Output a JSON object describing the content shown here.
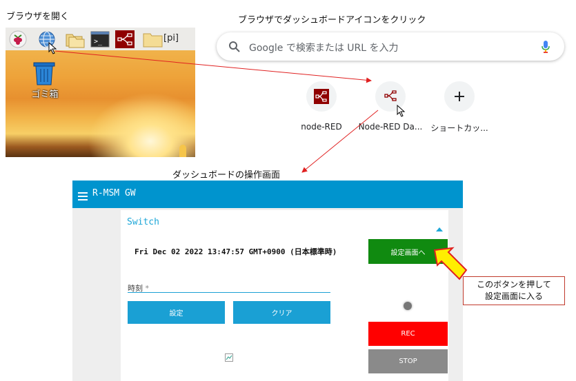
{
  "captions": {
    "open_browser": "ブラウザを開く",
    "click_dashboard_icon": "ブラウザでダッシュボードアイコンをクリック",
    "dashboard_screen": "ダッシュボードの操作画面"
  },
  "desktop": {
    "taskbar_items": [
      "raspberry-menu",
      "browser",
      "file-manager",
      "terminal",
      "node-red",
      "folder-pi"
    ],
    "folder_label": "[pi]",
    "trash_label": "ゴミ箱"
  },
  "browser": {
    "search_placeholder": "Google で検索または URL を入力",
    "shortcuts": [
      {
        "label": "node-RED",
        "icon": "node-red-icon"
      },
      {
        "label": "Node-RED Da...",
        "icon": "node-red-dashboard-icon"
      },
      {
        "label": "ショートカッ...",
        "icon": "add-icon"
      }
    ]
  },
  "dashboard": {
    "title": "R-MSM GW",
    "group_title": "Switch",
    "datetime": "Fri Dec 02 2022 13:47:57 GMT+0900 (日本標準時)",
    "settings_button": "設定画面へ",
    "time_field_label": "時刻",
    "time_field_required": "*",
    "set_button": "設定",
    "clear_button": "クリア",
    "rec_button": "REC",
    "stop_button": "STOP"
  },
  "callout": {
    "line1": "このボタンを押して",
    "line2": "設定画面に入る"
  },
  "colors": {
    "header": "#0094ce",
    "settings_green": "#108a10",
    "action_blue": "#1aa0d4",
    "rec_red": "#ff0000",
    "stop_gray": "#8a8a8a",
    "arrow_red": "#e02020",
    "callout_arrow_yellow": "#ffee00"
  }
}
